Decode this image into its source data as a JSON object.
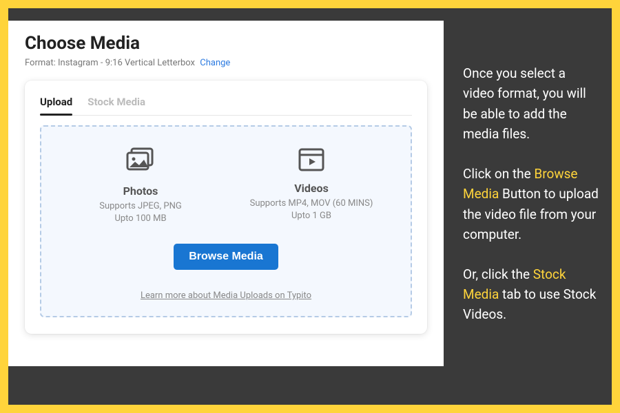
{
  "colors": {
    "accent_yellow": "#FFD43B",
    "panel_bg": "#3a3a3a",
    "link_blue": "#2d7be0",
    "button_blue": "#1976d2"
  },
  "panel": {
    "title": "Choose Media",
    "format_label": "Format:",
    "format_value": "Instagram - 9:16 Vertical Letterbox",
    "change_label": "Change"
  },
  "tabs": {
    "upload": "Upload",
    "stock": "Stock Media"
  },
  "dropzone": {
    "photos": {
      "title": "Photos",
      "line1": "Supports JPEG, PNG",
      "line2": "Upto 100 MB",
      "icon": "photos-icon"
    },
    "videos": {
      "title": "Videos",
      "line1": "Supports MP4, MOV (60 MINS)",
      "line2": "Upto 1 GB",
      "icon": "videos-icon"
    },
    "browse_label": "Browse Media",
    "learn_more": "Learn more about Media Uploads on Typito"
  },
  "sidetext": {
    "p1": "Once you select a video format, you will be able to add the media files.",
    "p2a": "Click on the ",
    "p2_hl": "Browse Media",
    "p2b": " Button to upload the video file from your computer.",
    "p3a": "Or, click the ",
    "p3_hl": "Stock Media",
    "p3b": " tab to use Stock Videos."
  }
}
